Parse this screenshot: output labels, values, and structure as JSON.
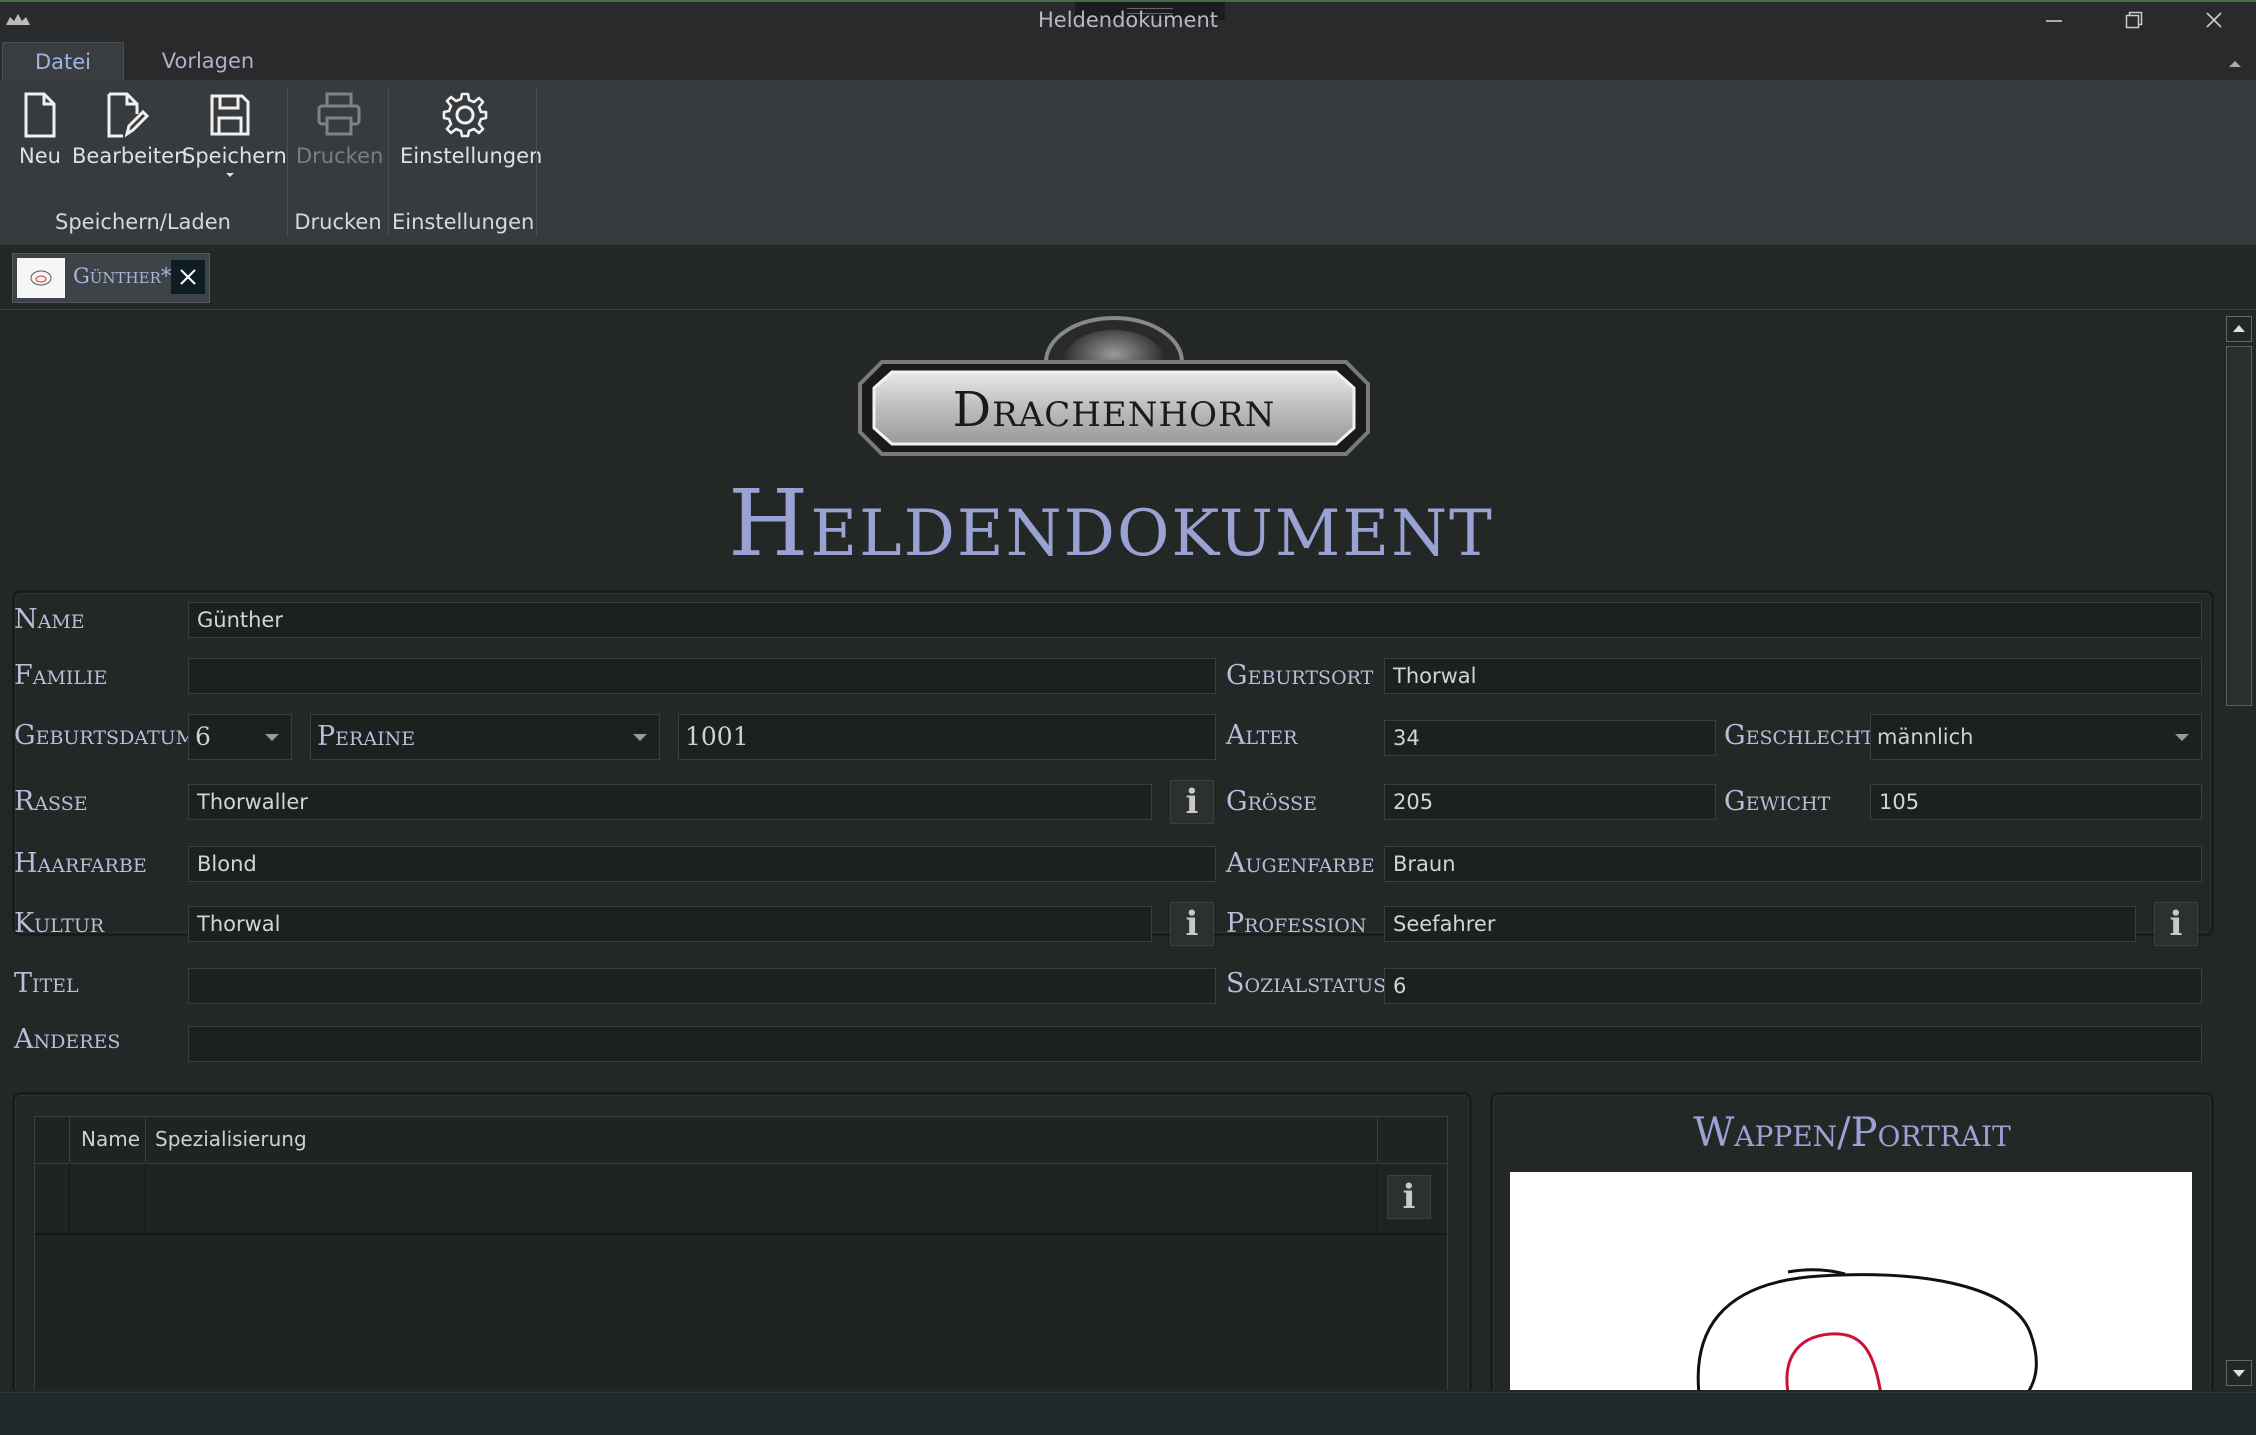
{
  "window": {
    "title": "Heldendokument"
  },
  "ribbon": {
    "tabs": [
      "Datei",
      "Vorlagen"
    ],
    "buttons": {
      "neu": "Neu",
      "bearbeiten": "Bearbeiten",
      "speichern": "Speichern",
      "drucken": "Drucken",
      "einstellungen": "Einstellungen"
    },
    "groups": {
      "speichern_laden": "Speichern/Laden",
      "drucken": "Drucken",
      "einstellungen": "Einstellungen"
    }
  },
  "doc_tab": {
    "label": "Günther*"
  },
  "header": {
    "logo_text": "Drachenhorn",
    "title": "Heldendokument"
  },
  "form": {
    "labels": {
      "name": "Name",
      "familie": "Familie",
      "geburtsort": "Geburtsort",
      "geburtsdatum": "Geburtsdatum",
      "alter": "Alter",
      "geschlecht": "Geschlecht",
      "rasse": "Rasse",
      "groesse": "Größe",
      "gewicht": "Gewicht",
      "haarfarbe": "Haarfarbe",
      "augenfarbe": "Augenfarbe",
      "kultur": "Kultur",
      "profession": "Profession",
      "titel": "Titel",
      "sozialstatus": "Sozialstatus",
      "anderes": "Anderes"
    },
    "values": {
      "name": "Günther",
      "familie": "",
      "geburtsort": "Thorwal",
      "geburtsdatum_tag": "6",
      "geburtsdatum_monat": "Peraine",
      "geburtsdatum_jahr": "1001",
      "alter": "34",
      "geschlecht": "männlich",
      "rasse": "Thorwaller",
      "groesse": "205",
      "gewicht": "105",
      "haarfarbe": "Blond",
      "augenfarbe": "Braun",
      "kultur": "Thorwal",
      "profession": "Seefahrer",
      "titel": "",
      "sozialstatus": "6",
      "anderes": ""
    },
    "info_glyph": "i"
  },
  "table": {
    "columns": [
      "Name",
      "Spezialisierung"
    ]
  },
  "portrait": {
    "title": "Wappen/Portrait"
  }
}
